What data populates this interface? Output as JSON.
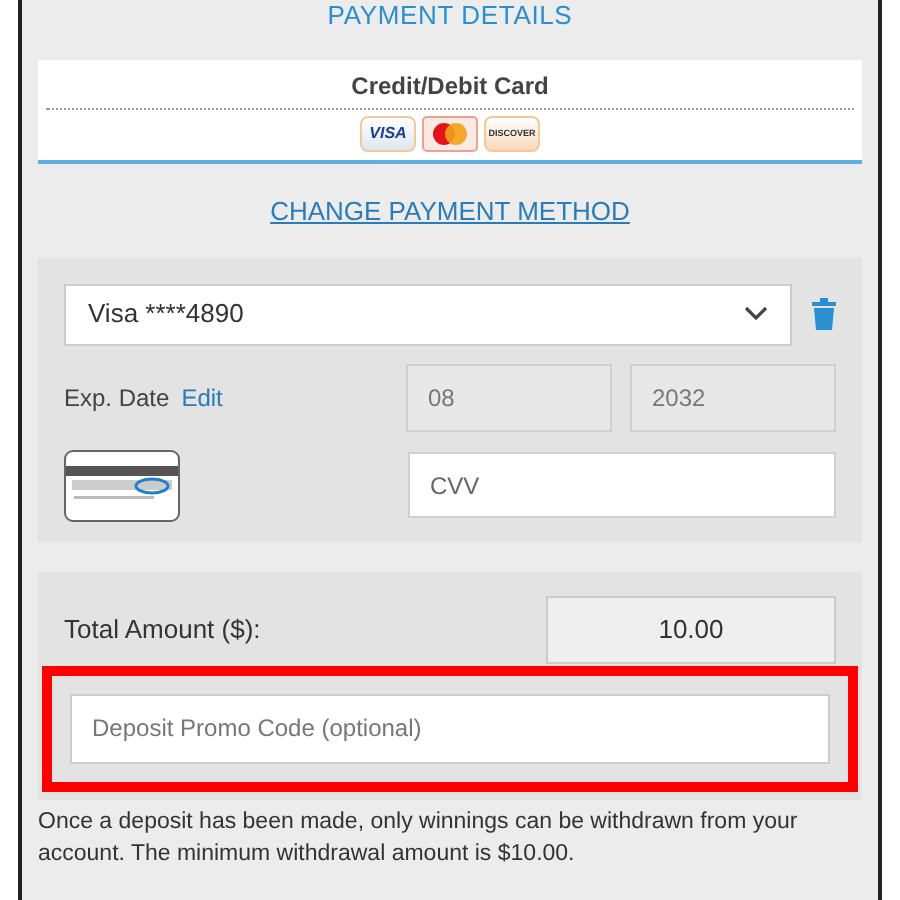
{
  "title": "PAYMENT DETAILS",
  "payment_method": {
    "label": "Credit/Debit Card",
    "cards": [
      {
        "kind": "visa",
        "label": "VISA"
      },
      {
        "kind": "mastercard"
      },
      {
        "kind": "discover",
        "label": "DISCOVER"
      }
    ]
  },
  "change_link": "CHANGE PAYMENT METHOD",
  "card_select": {
    "value": "Visa ****4890"
  },
  "exp_date": {
    "label": "Exp. Date",
    "edit": "Edit",
    "month": "08",
    "year": "2032"
  },
  "cvv": {
    "placeholder": "CVV"
  },
  "total": {
    "label": "Total Amount ($):",
    "value": "10.00"
  },
  "promo": {
    "placeholder": "Deposit Promo Code (optional)",
    "highlighted": true
  },
  "notice": "Once a deposit has been made, only winnings can be withdrawn from your account. The minimum withdrawal amount is $10.00."
}
